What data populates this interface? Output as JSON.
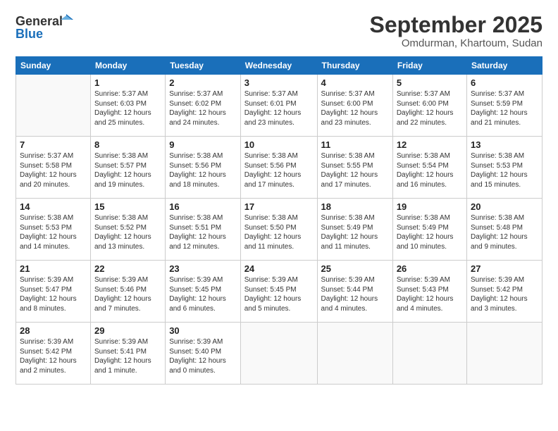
{
  "header": {
    "logo_general": "General",
    "logo_blue": "Blue",
    "month_title": "September 2025",
    "location": "Omdurman, Khartoum, Sudan"
  },
  "columns": [
    "Sunday",
    "Monday",
    "Tuesday",
    "Wednesday",
    "Thursday",
    "Friday",
    "Saturday"
  ],
  "weeks": [
    [
      {
        "day": "",
        "info": ""
      },
      {
        "day": "1",
        "info": "Sunrise: 5:37 AM\nSunset: 6:03 PM\nDaylight: 12 hours\nand 25 minutes."
      },
      {
        "day": "2",
        "info": "Sunrise: 5:37 AM\nSunset: 6:02 PM\nDaylight: 12 hours\nand 24 minutes."
      },
      {
        "day": "3",
        "info": "Sunrise: 5:37 AM\nSunset: 6:01 PM\nDaylight: 12 hours\nand 23 minutes."
      },
      {
        "day": "4",
        "info": "Sunrise: 5:37 AM\nSunset: 6:00 PM\nDaylight: 12 hours\nand 23 minutes."
      },
      {
        "day": "5",
        "info": "Sunrise: 5:37 AM\nSunset: 6:00 PM\nDaylight: 12 hours\nand 22 minutes."
      },
      {
        "day": "6",
        "info": "Sunrise: 5:37 AM\nSunset: 5:59 PM\nDaylight: 12 hours\nand 21 minutes."
      }
    ],
    [
      {
        "day": "7",
        "info": "Sunrise: 5:37 AM\nSunset: 5:58 PM\nDaylight: 12 hours\nand 20 minutes."
      },
      {
        "day": "8",
        "info": "Sunrise: 5:38 AM\nSunset: 5:57 PM\nDaylight: 12 hours\nand 19 minutes."
      },
      {
        "day": "9",
        "info": "Sunrise: 5:38 AM\nSunset: 5:56 PM\nDaylight: 12 hours\nand 18 minutes."
      },
      {
        "day": "10",
        "info": "Sunrise: 5:38 AM\nSunset: 5:56 PM\nDaylight: 12 hours\nand 17 minutes."
      },
      {
        "day": "11",
        "info": "Sunrise: 5:38 AM\nSunset: 5:55 PM\nDaylight: 12 hours\nand 17 minutes."
      },
      {
        "day": "12",
        "info": "Sunrise: 5:38 AM\nSunset: 5:54 PM\nDaylight: 12 hours\nand 16 minutes."
      },
      {
        "day": "13",
        "info": "Sunrise: 5:38 AM\nSunset: 5:53 PM\nDaylight: 12 hours\nand 15 minutes."
      }
    ],
    [
      {
        "day": "14",
        "info": "Sunrise: 5:38 AM\nSunset: 5:53 PM\nDaylight: 12 hours\nand 14 minutes."
      },
      {
        "day": "15",
        "info": "Sunrise: 5:38 AM\nSunset: 5:52 PM\nDaylight: 12 hours\nand 13 minutes."
      },
      {
        "day": "16",
        "info": "Sunrise: 5:38 AM\nSunset: 5:51 PM\nDaylight: 12 hours\nand 12 minutes."
      },
      {
        "day": "17",
        "info": "Sunrise: 5:38 AM\nSunset: 5:50 PM\nDaylight: 12 hours\nand 11 minutes."
      },
      {
        "day": "18",
        "info": "Sunrise: 5:38 AM\nSunset: 5:49 PM\nDaylight: 12 hours\nand 11 minutes."
      },
      {
        "day": "19",
        "info": "Sunrise: 5:38 AM\nSunset: 5:49 PM\nDaylight: 12 hours\nand 10 minutes."
      },
      {
        "day": "20",
        "info": "Sunrise: 5:38 AM\nSunset: 5:48 PM\nDaylight: 12 hours\nand 9 minutes."
      }
    ],
    [
      {
        "day": "21",
        "info": "Sunrise: 5:39 AM\nSunset: 5:47 PM\nDaylight: 12 hours\nand 8 minutes."
      },
      {
        "day": "22",
        "info": "Sunrise: 5:39 AM\nSunset: 5:46 PM\nDaylight: 12 hours\nand 7 minutes."
      },
      {
        "day": "23",
        "info": "Sunrise: 5:39 AM\nSunset: 5:45 PM\nDaylight: 12 hours\nand 6 minutes."
      },
      {
        "day": "24",
        "info": "Sunrise: 5:39 AM\nSunset: 5:45 PM\nDaylight: 12 hours\nand 5 minutes."
      },
      {
        "day": "25",
        "info": "Sunrise: 5:39 AM\nSunset: 5:44 PM\nDaylight: 12 hours\nand 4 minutes."
      },
      {
        "day": "26",
        "info": "Sunrise: 5:39 AM\nSunset: 5:43 PM\nDaylight: 12 hours\nand 4 minutes."
      },
      {
        "day": "27",
        "info": "Sunrise: 5:39 AM\nSunset: 5:42 PM\nDaylight: 12 hours\nand 3 minutes."
      }
    ],
    [
      {
        "day": "28",
        "info": "Sunrise: 5:39 AM\nSunset: 5:42 PM\nDaylight: 12 hours\nand 2 minutes."
      },
      {
        "day": "29",
        "info": "Sunrise: 5:39 AM\nSunset: 5:41 PM\nDaylight: 12 hours\nand 1 minute."
      },
      {
        "day": "30",
        "info": "Sunrise: 5:39 AM\nSunset: 5:40 PM\nDaylight: 12 hours\nand 0 minutes."
      },
      {
        "day": "",
        "info": ""
      },
      {
        "day": "",
        "info": ""
      },
      {
        "day": "",
        "info": ""
      },
      {
        "day": "",
        "info": ""
      }
    ]
  ]
}
